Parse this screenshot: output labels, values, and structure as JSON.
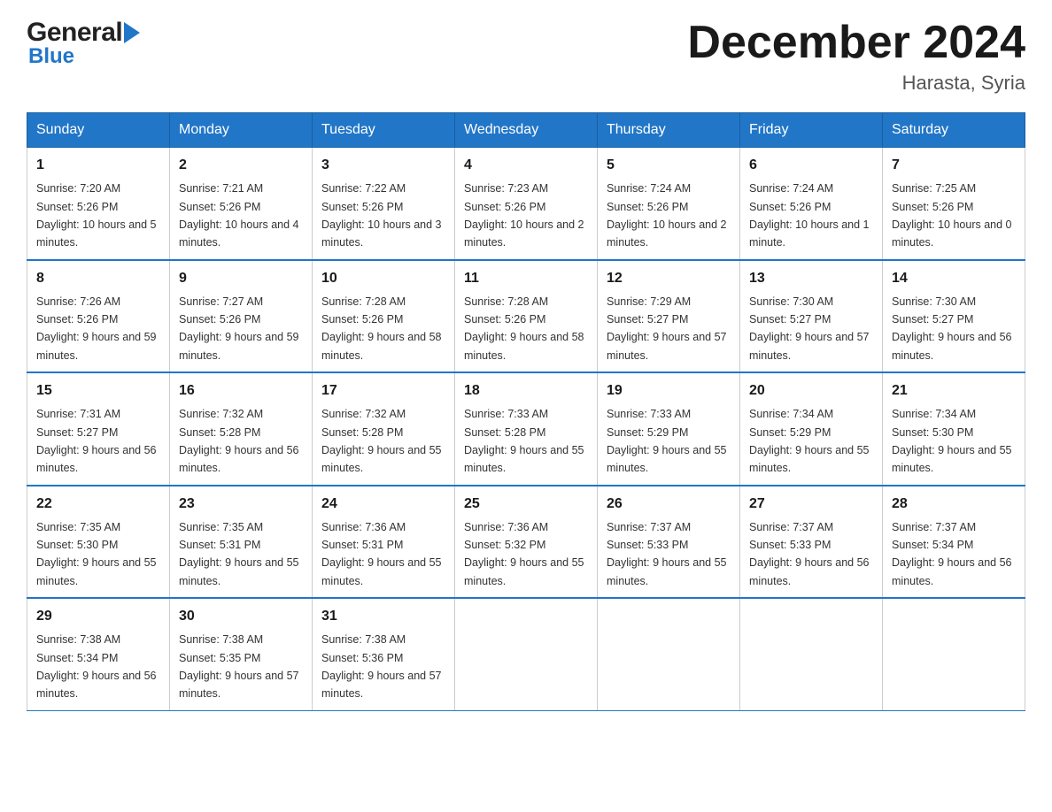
{
  "header": {
    "logo_general": "General",
    "logo_blue": "Blue",
    "main_title": "December 2024",
    "subtitle": "Harasta, Syria"
  },
  "calendar": {
    "days_of_week": [
      "Sunday",
      "Monday",
      "Tuesday",
      "Wednesday",
      "Thursday",
      "Friday",
      "Saturday"
    ],
    "weeks": [
      [
        {
          "day": "1",
          "sunrise": "7:20 AM",
          "sunset": "5:26 PM",
          "daylight": "10 hours and 5 minutes."
        },
        {
          "day": "2",
          "sunrise": "7:21 AM",
          "sunset": "5:26 PM",
          "daylight": "10 hours and 4 minutes."
        },
        {
          "day": "3",
          "sunrise": "7:22 AM",
          "sunset": "5:26 PM",
          "daylight": "10 hours and 3 minutes."
        },
        {
          "day": "4",
          "sunrise": "7:23 AM",
          "sunset": "5:26 PM",
          "daylight": "10 hours and 2 minutes."
        },
        {
          "day": "5",
          "sunrise": "7:24 AM",
          "sunset": "5:26 PM",
          "daylight": "10 hours and 2 minutes."
        },
        {
          "day": "6",
          "sunrise": "7:24 AM",
          "sunset": "5:26 PM",
          "daylight": "10 hours and 1 minute."
        },
        {
          "day": "7",
          "sunrise": "7:25 AM",
          "sunset": "5:26 PM",
          "daylight": "10 hours and 0 minutes."
        }
      ],
      [
        {
          "day": "8",
          "sunrise": "7:26 AM",
          "sunset": "5:26 PM",
          "daylight": "9 hours and 59 minutes."
        },
        {
          "day": "9",
          "sunrise": "7:27 AM",
          "sunset": "5:26 PM",
          "daylight": "9 hours and 59 minutes."
        },
        {
          "day": "10",
          "sunrise": "7:28 AM",
          "sunset": "5:26 PM",
          "daylight": "9 hours and 58 minutes."
        },
        {
          "day": "11",
          "sunrise": "7:28 AM",
          "sunset": "5:26 PM",
          "daylight": "9 hours and 58 minutes."
        },
        {
          "day": "12",
          "sunrise": "7:29 AM",
          "sunset": "5:27 PM",
          "daylight": "9 hours and 57 minutes."
        },
        {
          "day": "13",
          "sunrise": "7:30 AM",
          "sunset": "5:27 PM",
          "daylight": "9 hours and 57 minutes."
        },
        {
          "day": "14",
          "sunrise": "7:30 AM",
          "sunset": "5:27 PM",
          "daylight": "9 hours and 56 minutes."
        }
      ],
      [
        {
          "day": "15",
          "sunrise": "7:31 AM",
          "sunset": "5:27 PM",
          "daylight": "9 hours and 56 minutes."
        },
        {
          "day": "16",
          "sunrise": "7:32 AM",
          "sunset": "5:28 PM",
          "daylight": "9 hours and 56 minutes."
        },
        {
          "day": "17",
          "sunrise": "7:32 AM",
          "sunset": "5:28 PM",
          "daylight": "9 hours and 55 minutes."
        },
        {
          "day": "18",
          "sunrise": "7:33 AM",
          "sunset": "5:28 PM",
          "daylight": "9 hours and 55 minutes."
        },
        {
          "day": "19",
          "sunrise": "7:33 AM",
          "sunset": "5:29 PM",
          "daylight": "9 hours and 55 minutes."
        },
        {
          "day": "20",
          "sunrise": "7:34 AM",
          "sunset": "5:29 PM",
          "daylight": "9 hours and 55 minutes."
        },
        {
          "day": "21",
          "sunrise": "7:34 AM",
          "sunset": "5:30 PM",
          "daylight": "9 hours and 55 minutes."
        }
      ],
      [
        {
          "day": "22",
          "sunrise": "7:35 AM",
          "sunset": "5:30 PM",
          "daylight": "9 hours and 55 minutes."
        },
        {
          "day": "23",
          "sunrise": "7:35 AM",
          "sunset": "5:31 PM",
          "daylight": "9 hours and 55 minutes."
        },
        {
          "day": "24",
          "sunrise": "7:36 AM",
          "sunset": "5:31 PM",
          "daylight": "9 hours and 55 minutes."
        },
        {
          "day": "25",
          "sunrise": "7:36 AM",
          "sunset": "5:32 PM",
          "daylight": "9 hours and 55 minutes."
        },
        {
          "day": "26",
          "sunrise": "7:37 AM",
          "sunset": "5:33 PM",
          "daylight": "9 hours and 55 minutes."
        },
        {
          "day": "27",
          "sunrise": "7:37 AM",
          "sunset": "5:33 PM",
          "daylight": "9 hours and 56 minutes."
        },
        {
          "day": "28",
          "sunrise": "7:37 AM",
          "sunset": "5:34 PM",
          "daylight": "9 hours and 56 minutes."
        }
      ],
      [
        {
          "day": "29",
          "sunrise": "7:38 AM",
          "sunset": "5:34 PM",
          "daylight": "9 hours and 56 minutes."
        },
        {
          "day": "30",
          "sunrise": "7:38 AM",
          "sunset": "5:35 PM",
          "daylight": "9 hours and 57 minutes."
        },
        {
          "day": "31",
          "sunrise": "7:38 AM",
          "sunset": "5:36 PM",
          "daylight": "9 hours and 57 minutes."
        },
        null,
        null,
        null,
        null
      ]
    ],
    "labels": {
      "sunrise": "Sunrise:",
      "sunset": "Sunset:",
      "daylight": "Daylight:"
    }
  }
}
